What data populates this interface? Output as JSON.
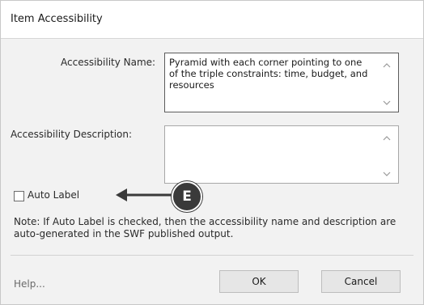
{
  "dialog": {
    "title": "Item Accessibility",
    "name_label": "Accessibility Name:",
    "name_value": "Pyramid with each corner pointing to one of the triple constraints: time, budget, and resources",
    "description_label": "Accessibility Description:",
    "description_value": "",
    "auto_label": {
      "label": "Auto Label",
      "checked": false
    },
    "note": "Note: If Auto Label is checked, then the accessibility name and description are auto-generated in the SWF published output.",
    "help_label": "Help...",
    "ok_label": "OK",
    "cancel_label": "Cancel"
  },
  "annotation": {
    "letter": "E",
    "color": "#3a3a3a"
  },
  "icons": {
    "scroll_up": "chevron-up-icon",
    "scroll_down": "chevron-down-icon",
    "arrow": "arrow-left-icon"
  }
}
